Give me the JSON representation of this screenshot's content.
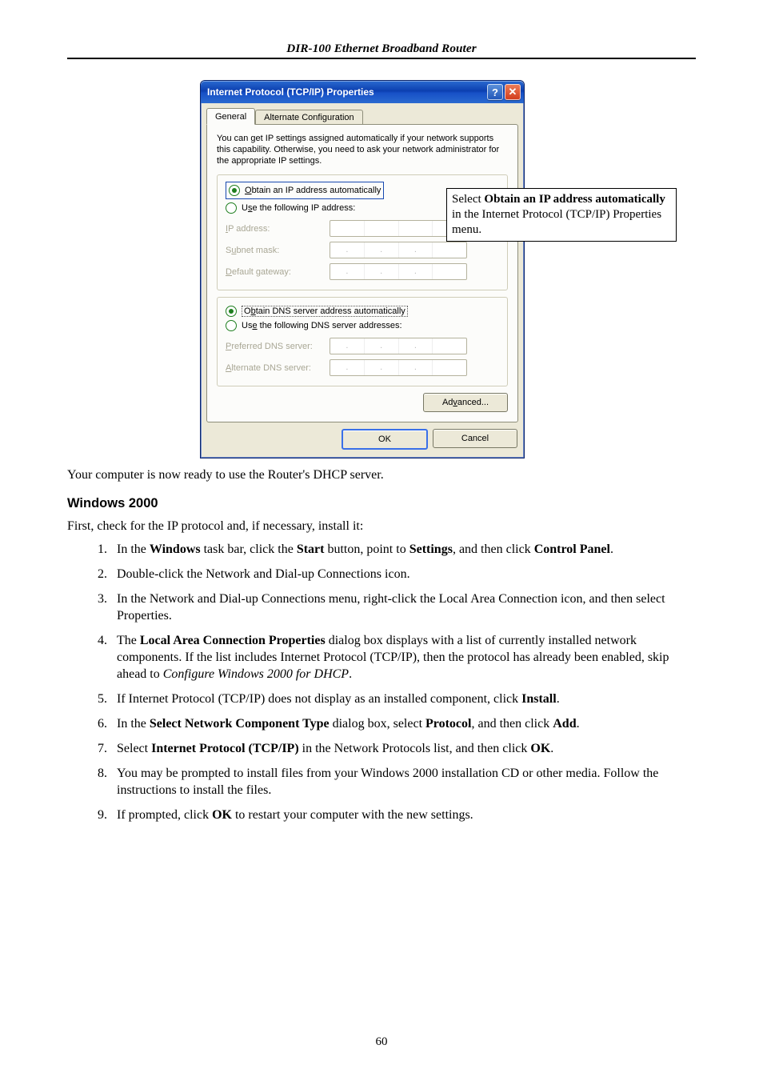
{
  "header": {
    "title": "DIR-100 Ethernet Broadband Router"
  },
  "dialog": {
    "title": "Internet Protocol (TCP/IP) Properties",
    "help_char": "?",
    "close_char": "✕",
    "tabs": {
      "general": "General",
      "alt": "Alternate Configuration"
    },
    "intro": "You can get IP settings assigned automatically if your network supports this capability. Otherwise, you need to ask your network administrator for the appropriate IP settings.",
    "radio": {
      "obtain_ip": "Obtain an IP address automatically",
      "use_ip": "Use the following IP address:",
      "obtain_dns": "Obtain DNS server address automatically",
      "use_dns": "Use the following DNS server addresses:"
    },
    "labels": {
      "ip_address": "IP address:",
      "subnet_mask": "Subnet mask:",
      "default_gateway": "Default gateway:",
      "preferred_dns": "Preferred DNS server:",
      "alternate_dns": "Alternate DNS server:"
    },
    "buttons": {
      "advanced": "Advanced...",
      "ok": "OK",
      "cancel": "Cancel"
    }
  },
  "callout": {
    "text_prefix": "Select ",
    "bold": "Obtain an IP address automatically",
    "text_suffix": " in the Internet Protocol (TCP/IP) Properties menu."
  },
  "body": {
    "ready_text": "Your computer is now ready to use the Router's DHCP server.",
    "win2000_heading": "Windows 2000",
    "first_check": "First, check for the IP protocol and, if necessary, install it:",
    "steps": {
      "s1_a": "In the ",
      "s1_b": "Windows",
      "s1_c": " task bar, click the ",
      "s1_d": "Start",
      "s1_e": " button, point to ",
      "s1_f": "Settings",
      "s1_g": ", and then click ",
      "s1_h": "Control Panel",
      "s1_i": ".",
      "s2": "Double-click the Network and Dial-up Connections icon.",
      "s3": "In the Network and Dial-up Connections menu, right-click the Local Area Connection icon, and then select Properties.",
      "s4_a": "The ",
      "s4_b": "Local Area Connection Properties",
      "s4_c": " dialog box displays with a list of currently installed network components. If the list includes Internet Protocol (TCP/IP), then the protocol has already been enabled, skip ahead to ",
      "s4_d": "Configure Windows 2000 for DHCP",
      "s4_e": ".",
      "s5_a": "If Internet Protocol (TCP/IP) does not display as an installed component, click ",
      "s5_b": "Install",
      "s5_c": ".",
      "s6_a": "In the ",
      "s6_b": "Select Network Component Type",
      "s6_c": " dialog box, select ",
      "s6_d": "Protocol",
      "s6_e": ", and then click ",
      "s6_f": "Add",
      "s6_g": ".",
      "s7_a": "Select ",
      "s7_b": "Internet Protocol (TCP/IP)",
      "s7_c": " in the Network Protocols list, and then click ",
      "s7_d": "OK",
      "s7_e": ".",
      "s8": "You may be prompted to install files from your Windows 2000 installation CD or other media. Follow the instructions to install the files.",
      "s9_a": "If prompted, click ",
      "s9_b": "OK",
      "s9_c": " to restart your computer with the new settings."
    }
  },
  "page_number": "60"
}
